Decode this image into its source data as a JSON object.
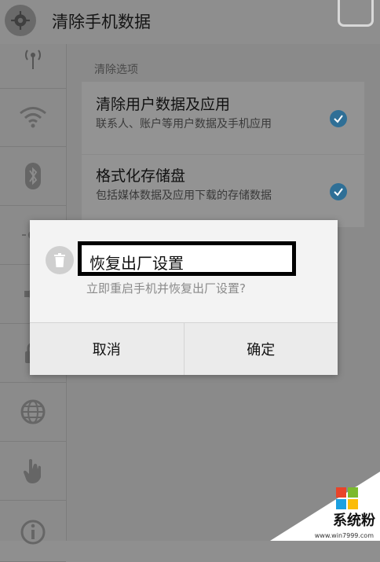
{
  "header": {
    "title": "清除手机数据",
    "settings_icon": "gear-icon",
    "search_icon": "search-icon"
  },
  "sidebar": {
    "items": [
      {
        "icon": "signal-tower-icon"
      },
      {
        "icon": "wifi-icon"
      },
      {
        "icon": "bluetooth-icon"
      },
      {
        "icon": "brightness-icon"
      },
      {
        "icon": "volume-icon"
      },
      {
        "icon": "lock-icon"
      },
      {
        "icon": "globe-icon"
      },
      {
        "icon": "hand-touch-icon"
      },
      {
        "icon": "info-icon"
      }
    ]
  },
  "content": {
    "section_label": "清除选项",
    "options": [
      {
        "title": "清除用户数据及应用",
        "desc": "联系人、账户等用户数据及手机应用",
        "checked": true
      },
      {
        "title": "格式化存储盘",
        "desc": "包括媒体数据及应用下载的存储数据",
        "checked": true
      }
    ]
  },
  "dialog": {
    "icon": "trash-icon",
    "title": "恢复出厂设置",
    "message": "立即重启手机并恢复出厂设置?",
    "cancel_label": "取消",
    "ok_label": "确定"
  },
  "watermark": {
    "text": "系统粉",
    "url": "www.win7999.com"
  },
  "colors": {
    "accent": "#2f6f96",
    "highlight_border": "#000000"
  }
}
